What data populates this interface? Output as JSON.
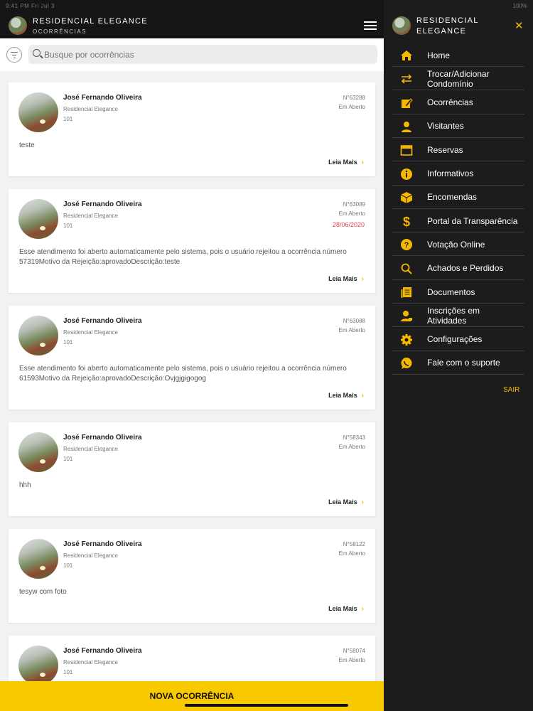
{
  "header": {
    "status_time": "9:41 PM  Fri Jul 3",
    "title": "RESIDENCIAL ELEGANCE",
    "subtitle": "OCORRÊNCIAS"
  },
  "search": {
    "placeholder": "Busque por ocorrências"
  },
  "cards": [
    {
      "name": "José Fernando Oliveira",
      "condo": "Residencial Elegance",
      "unit": "101",
      "number": "N°63288",
      "status": "Em Aberto",
      "date": "",
      "description": "teste",
      "more": "Leia Mais"
    },
    {
      "name": "José Fernando Oliveira",
      "condo": "Residencial Elegance",
      "unit": "101",
      "number": "N°63089",
      "status": "Em Aberto",
      "date": "28/06/2020",
      "description": "Esse atendimento foi aberto automaticamente pelo sistema, pois o usuário rejeitou a ocorrência número 57319Motivo da Rejeição:aprovadoDescrição:teste",
      "more": "Leia Mais"
    },
    {
      "name": "José Fernando Oliveira",
      "condo": "Residencial Elegance",
      "unit": "101",
      "number": "N°63088",
      "status": "Em Aberto",
      "date": "",
      "description": "Esse atendimento foi aberto automaticamente pelo sistema, pois o usuário rejeitou a ocorrência número 61593Motivo da Rejeição:aprovadoDescrição:Ovjgjgigogog",
      "more": "Leia Mais"
    },
    {
      "name": "José Fernando Oliveira",
      "condo": "Residencial Elegance",
      "unit": "101",
      "number": "N°58343",
      "status": "Em Aberto",
      "date": "",
      "description": "hhh",
      "more": "Leia Mais"
    },
    {
      "name": "José Fernando Oliveira",
      "condo": "Residencial Elegance",
      "unit": "101",
      "number": "N°58122",
      "status": "Em Aberto",
      "date": "",
      "description": "tesyw com foto",
      "more": "Leia Mais"
    },
    {
      "name": "José Fernando Oliveira",
      "condo": "Residencial Elegance",
      "unit": "101",
      "number": "N°58074",
      "status": "Em Aberto",
      "date": "",
      "description": "",
      "more": ""
    }
  ],
  "new_button": "NOVA OCORRÊNCIA",
  "drawer": {
    "status_right": "100%",
    "title": "RESIDENCIAL ELEGANCE",
    "close_icon": "✕",
    "menu": [
      {
        "label": "Home",
        "icon": "home-icon"
      },
      {
        "label": "Trocar/Adicionar Condomínio",
        "icon": "swap-arrows-icon"
      },
      {
        "label": "Ocorrências",
        "icon": "edit-note-icon"
      },
      {
        "label": "Visitantes",
        "icon": "person-icon"
      },
      {
        "label": "Reservas",
        "icon": "calendar-icon"
      },
      {
        "label": "Informativos",
        "icon": "info-icon"
      },
      {
        "label": "Encomendas",
        "icon": "package-icon"
      },
      {
        "label": "Portal da Transparência",
        "icon": "dollar-icon"
      },
      {
        "label": "Votação Online",
        "icon": "question-icon"
      },
      {
        "label": "Achados e Perdidos",
        "icon": "search-icon"
      },
      {
        "label": "Documentos",
        "icon": "documents-icon"
      },
      {
        "label": "Inscrições em Atividades",
        "icon": "person-badge-icon"
      },
      {
        "label": "Configurações",
        "icon": "gear-icon"
      },
      {
        "label": "Fale com o suporte",
        "icon": "whatsapp-icon"
      }
    ],
    "logout": "SAIR"
  },
  "colors": {
    "accent": "#f9c900",
    "icon": "#f5b800",
    "dark": "#151515",
    "date_red": "#e0474c"
  }
}
